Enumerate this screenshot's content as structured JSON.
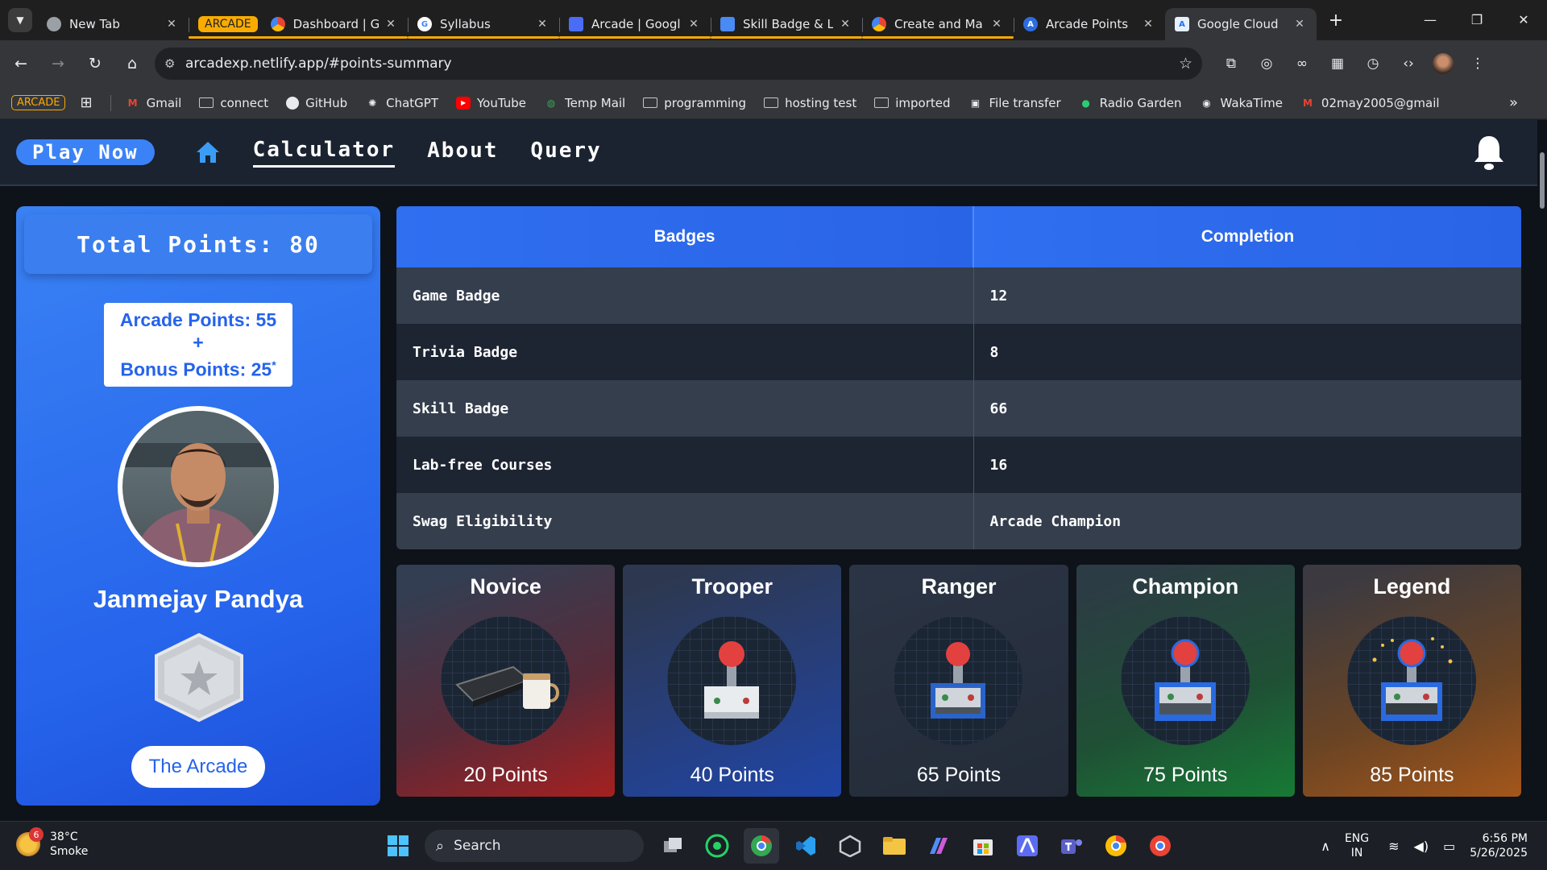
{
  "browser": {
    "tabs": [
      {
        "title": "New Tab",
        "fav_color": "#9aa0a6",
        "fav_text": ""
      },
      {
        "group": "ARCADE",
        "title": "Dashboard | Gc",
        "fav_color": "#4285f4",
        "fav_text": ""
      },
      {
        "title": "Syllabus",
        "fav_color": "#ffffff",
        "fav_text": "G"
      },
      {
        "title": "Arcade | Googl",
        "fav_color": "#4a6cf7",
        "fav_text": ""
      },
      {
        "title": "Skill Badge & L",
        "fav_color": "#4a8af4",
        "fav_text": ""
      },
      {
        "title": "Create and Ma",
        "fav_color": "#4285f4",
        "fav_text": ""
      },
      {
        "title": "Arcade Points",
        "fav_color": "#2d6cdf",
        "fav_text": "A"
      },
      {
        "title": "Google Cloud",
        "fav_color": "#8ab4f8",
        "fav_text": "A"
      }
    ],
    "url": "arcadexp.netlify.app/#points-summary",
    "bookmarks": {
      "group_label": "ARCADE",
      "items": [
        "Gmail",
        "connect",
        "GitHub",
        "ChatGPT",
        "YouTube",
        "Temp Mail",
        "programming",
        "hosting test",
        "imported",
        "File transfer",
        "Radio Garden",
        "WakaTime",
        "02may2005@gmail"
      ]
    }
  },
  "site": {
    "play_button": "Play Now",
    "nav": [
      "Calculator",
      "About",
      "Query"
    ],
    "profile": {
      "total_points": "Total Points: 80",
      "arcade_points": "Arcade Points: 55",
      "plus": "+",
      "bonus_points": "Bonus Points: 25",
      "bonus_mark": "*",
      "name": "Janmejay Pandya",
      "button": "The Arcade"
    },
    "table": {
      "headers": [
        "Badges",
        "Completion"
      ],
      "rows": [
        [
          "Game Badge",
          "12"
        ],
        [
          "Trivia Badge",
          "8"
        ],
        [
          "Skill Badge",
          "66"
        ],
        [
          "Lab-free Courses",
          "16"
        ],
        [
          "Swag Eligibility",
          "Arcade Champion"
        ]
      ]
    },
    "tiers": [
      {
        "name": "Novice",
        "points": "20 Points"
      },
      {
        "name": "Trooper",
        "points": "40 Points"
      },
      {
        "name": "Ranger",
        "points": "65 Points"
      },
      {
        "name": "Champion",
        "points": "75 Points"
      },
      {
        "name": "Legend",
        "points": "85 Points"
      }
    ]
  },
  "taskbar": {
    "weather_badge": "6",
    "temperature": "38°C",
    "condition": "Smoke",
    "search": "Search",
    "lang_1": "ENG",
    "lang_2": "IN",
    "time": "6:56 PM",
    "date": "5/26/2025"
  }
}
